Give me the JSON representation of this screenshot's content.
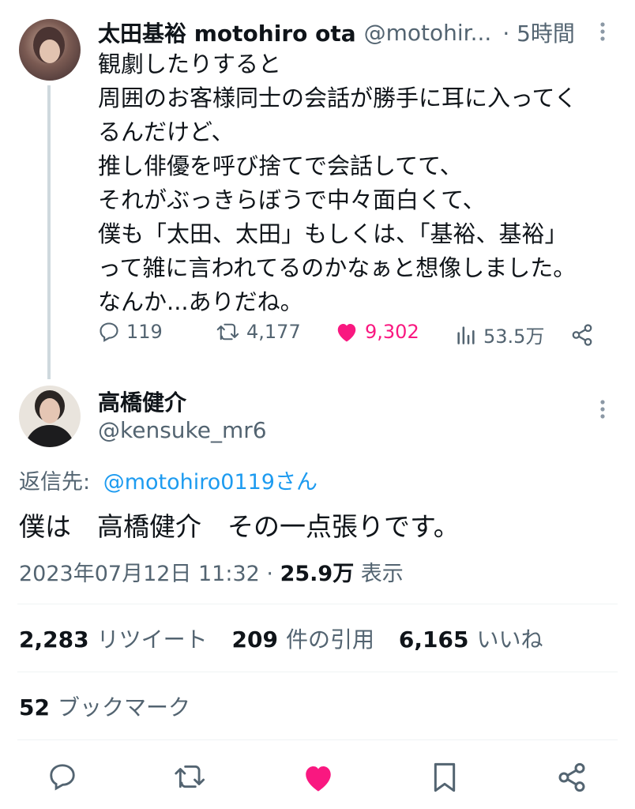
{
  "tweet1": {
    "display_name": "太田基裕 motohiro ota",
    "handle": "@motohir...",
    "time": "· 5時間",
    "text": "観劇したりすると\n周囲のお客様同士の会話が勝手に耳に入ってく\nるんだけど、\n推し俳優を呼び捨てで会話してて、\nそれがぶっきらぼうで中々面白くて、\n僕も「太田、太田」もしくは、「基裕、基裕」\nって雑に言われてるのかなぁと想像しました。\nなんか...ありだね。",
    "replies": "119",
    "retweets": "4,177",
    "likes": "9,302",
    "views": "53.5万"
  },
  "tweet2": {
    "display_name": "高橋健介",
    "handle": "@kensuke_mr6",
    "reply_to_label": "返信先:",
    "reply_to_handle": "@motohiro0119さん",
    "text": "僕は　高橋健介　その一点張りです。",
    "timestamp": "2023年07月12日 11:32 · ",
    "views_num": "25.9万",
    "views_label": " 表示",
    "retweets_num": "2,283",
    "retweets_label": "リツイート",
    "quotes_num": "209",
    "quotes_label": "件の引用",
    "likes_num": "6,165",
    "likes_label": "いいね",
    "bookmarks_num": "52",
    "bookmarks_label": "ブックマーク"
  },
  "icons": [
    "reply-icon",
    "retweet-icon",
    "heart-icon",
    "views-icon",
    "share-icon",
    "bookmark-icon",
    "more-icon"
  ],
  "colors": {
    "like": "#f91880",
    "link": "#1d9bf0",
    "muted": "#536471"
  }
}
